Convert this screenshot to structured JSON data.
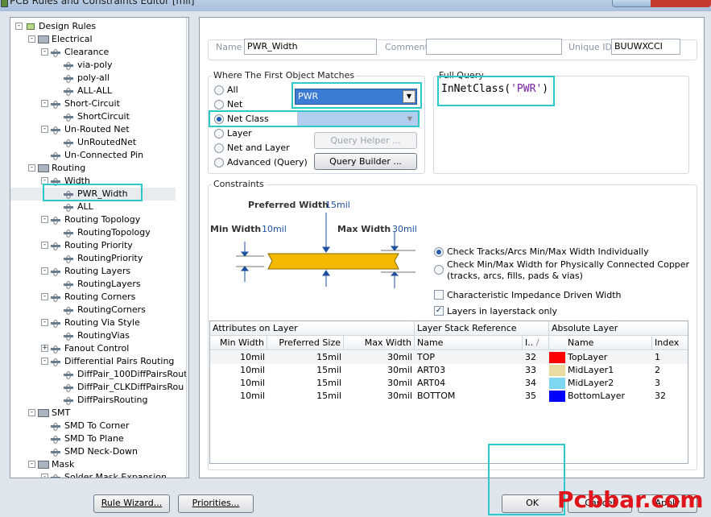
{
  "window": {
    "title": "PCB Rules and Constraints Editor [mil]"
  },
  "tree": {
    "items": [
      {
        "label": "Design Rules",
        "level": 0,
        "icon": "rules-root-icon",
        "expander": "-"
      },
      {
        "label": "Electrical",
        "level": 1,
        "icon": "rule-category-icon",
        "expander": "-"
      },
      {
        "label": "Clearance",
        "level": 2,
        "icon": "rule-type-icon",
        "expander": "-"
      },
      {
        "label": "via-poly",
        "level": 3,
        "icon": "rule-icon"
      },
      {
        "label": "poly-all",
        "level": 3,
        "icon": "rule-icon"
      },
      {
        "label": "ALL-ALL",
        "level": 3,
        "icon": "rule-icon"
      },
      {
        "label": "Short-Circuit",
        "level": 2,
        "icon": "rule-type-icon",
        "expander": "-"
      },
      {
        "label": "ShortCircuit",
        "level": 3,
        "icon": "rule-icon"
      },
      {
        "label": "Un-Routed Net",
        "level": 2,
        "icon": "rule-type-icon",
        "expander": "-"
      },
      {
        "label": "UnRoutedNet",
        "level": 3,
        "icon": "rule-icon"
      },
      {
        "label": "Un-Connected Pin",
        "level": 2,
        "icon": "rule-type-icon"
      },
      {
        "label": "Routing",
        "level": 1,
        "icon": "rule-category-icon",
        "expander": "-"
      },
      {
        "label": "Width",
        "level": 2,
        "icon": "rule-type-icon",
        "expander": "-"
      },
      {
        "label": "PWR_Width",
        "level": 3,
        "icon": "rule-icon",
        "selected": true
      },
      {
        "label": "ALL",
        "level": 3,
        "icon": "rule-icon"
      },
      {
        "label": "Routing Topology",
        "level": 2,
        "icon": "rule-type-icon",
        "expander": "-"
      },
      {
        "label": "RoutingTopology",
        "level": 3,
        "icon": "rule-icon"
      },
      {
        "label": "Routing Priority",
        "level": 2,
        "icon": "rule-type-icon",
        "expander": "-"
      },
      {
        "label": "RoutingPriority",
        "level": 3,
        "icon": "rule-icon"
      },
      {
        "label": "Routing Layers",
        "level": 2,
        "icon": "rule-type-icon",
        "expander": "-"
      },
      {
        "label": "RoutingLayers",
        "level": 3,
        "icon": "rule-icon"
      },
      {
        "label": "Routing Corners",
        "level": 2,
        "icon": "rule-type-icon",
        "expander": "-"
      },
      {
        "label": "RoutingCorners",
        "level": 3,
        "icon": "rule-icon"
      },
      {
        "label": "Routing Via Style",
        "level": 2,
        "icon": "rule-type-icon",
        "expander": "-"
      },
      {
        "label": "RoutingVias",
        "level": 3,
        "icon": "rule-icon"
      },
      {
        "label": "Fanout Control",
        "level": 2,
        "icon": "rule-type-icon",
        "expander": "+"
      },
      {
        "label": "Differential Pairs Routing",
        "level": 2,
        "icon": "rule-type-icon",
        "expander": "-"
      },
      {
        "label": "DiffPair_100DiffPairsRout",
        "level": 3,
        "icon": "rule-icon"
      },
      {
        "label": "DiffPair_CLKDiffPairsRou",
        "level": 3,
        "icon": "rule-icon"
      },
      {
        "label": "DiffPairsRouting",
        "level": 3,
        "icon": "rule-icon"
      },
      {
        "label": "SMT",
        "level": 1,
        "icon": "rule-category-icon",
        "expander": "-"
      },
      {
        "label": "SMD To Corner",
        "level": 2,
        "icon": "rule-type-icon"
      },
      {
        "label": "SMD To Plane",
        "level": 2,
        "icon": "rule-type-icon"
      },
      {
        "label": "SMD Neck-Down",
        "level": 2,
        "icon": "rule-type-icon"
      },
      {
        "label": "Mask",
        "level": 1,
        "icon": "rule-category-icon",
        "expander": "-"
      },
      {
        "label": "Solder Mask Expansion",
        "level": 2,
        "icon": "rule-type-icon",
        "expander": "-"
      }
    ]
  },
  "rule": {
    "name_label": "Name",
    "name_value": "PWR_Width",
    "comment_label": "Comment",
    "comment_value": "",
    "uid_label": "Unique ID",
    "uid_value": "BUUWXCCI"
  },
  "match": {
    "group_label": "Where The First Object Matches",
    "options": [
      "All",
      "Net",
      "Net Class",
      "Layer",
      "Net and Layer",
      "Advanced (Query)"
    ],
    "selected": "Net Class",
    "net_value": "PWR",
    "netclass_value": "",
    "query_helper": "Query Helper ...",
    "query_builder": "Query Builder ..."
  },
  "query": {
    "label": "Full Query",
    "fn": "InNetClass(",
    "arg": "'PWR'",
    "close": ")"
  },
  "constraints": {
    "group_label": "Constraints",
    "preferred_label": "Preferred Width",
    "preferred_value": "15mil",
    "min_label": "Min Width",
    "min_value": "10mil",
    "max_label": "Max Width",
    "max_value": "30mil",
    "radio1": "Check Tracks/Arcs Min/Max Width Individually",
    "radio2_line1": "Check Min/Max Width for Physically Connected Copper",
    "radio2_line2": "(tracks, arcs, fills, pads & vias)",
    "chk1": "Characteristic Impedance Driven Width",
    "chk2": "Layers in layerstack only",
    "chk1_checked": false,
    "chk2_checked": true
  },
  "grid": {
    "group1": "Attributes on Layer",
    "group2": "Layer Stack Reference",
    "group3": "Absolute Layer",
    "headers": [
      "Min Width",
      "Preferred Size",
      "Max Width",
      "Name",
      "I..",
      "Name",
      "Index"
    ],
    "sort_glyph": "/",
    "rows": [
      {
        "min": "10mil",
        "pref": "15mil",
        "max": "30mil",
        "name": "TOP",
        "idx": "32",
        "color": "#ff0000",
        "layer": "TopLayer",
        "aidx": "1"
      },
      {
        "min": "10mil",
        "pref": "15mil",
        "max": "30mil",
        "name": "ART03",
        "idx": "33",
        "color": "#e8dca0",
        "layer": "MidLayer1",
        "aidx": "2"
      },
      {
        "min": "10mil",
        "pref": "15mil",
        "max": "30mil",
        "name": "ART04",
        "idx": "34",
        "color": "#7ed6f0",
        "layer": "MidLayer2",
        "aidx": "3"
      },
      {
        "min": "10mil",
        "pref": "15mil",
        "max": "30mil",
        "name": "BOTTOM",
        "idx": "35",
        "color": "#0000ff",
        "layer": "BottomLayer",
        "aidx": "32"
      }
    ]
  },
  "footer": {
    "rule_wizard": "Rule Wizard...",
    "priorities": "Priorities...",
    "ok": "OK",
    "cancel": "Cancel",
    "apply": "Apply"
  },
  "watermark": "Pcbbar.com",
  "colors": {
    "highlight": "#2ec8cb",
    "track": "#f5b800",
    "selection": "#3a7bd5"
  }
}
